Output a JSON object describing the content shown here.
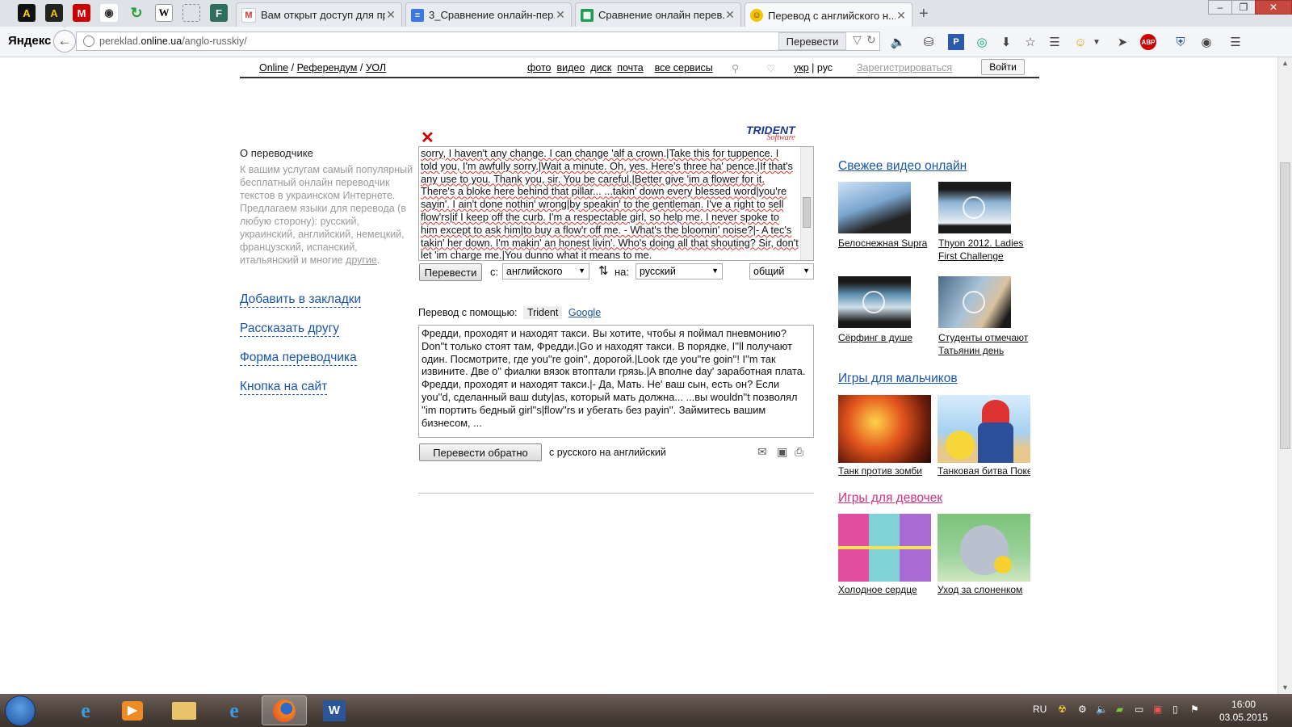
{
  "browser": {
    "tabs": [
      {
        "title": "Вам открыт доступ для пр...",
        "icon": "gmail-icon"
      },
      {
        "title": "3_Сравнение онлайн-пер...",
        "icon": "docs-icon"
      },
      {
        "title": "Сравнение онлайн перев...",
        "icon": "sheets-icon"
      },
      {
        "title": "Перевод с английского н...",
        "icon": "smiley-icon",
        "active": true
      }
    ],
    "logo": "Яндекс",
    "url_prefix": "pereklad.",
    "url_domain": "online.ua",
    "url_path": "/anglo-russkiy/",
    "translate_button": "Перевести",
    "abp_badge": "ABP"
  },
  "topnav": {
    "online": "Online",
    "referendum": "Референдум",
    "uol": "УОЛ",
    "sep": "/",
    "foto": "фото",
    "video": "видео",
    "disk": "диск",
    "pochta": "почта",
    "all_services": "все сервисы",
    "ukr": "укр",
    "lang_sep": "|",
    "rus": "рус",
    "register": "Зарегистрироваться",
    "login": "Войти"
  },
  "sidebar": {
    "title": "О переводчике",
    "description": "К вашим услугам самый популярный бесплатный онлайн переводчик текстов в украинском Интернете. Предлагаем языки для перевода (в любую сторону): русский, украинский, английский, немецкий, французский, испанский, итальянский и многие ",
    "others_link": "другие",
    "period": ".",
    "links": [
      "Добавить в закладки",
      "Рассказать другу",
      "Форма переводчика",
      "Кнопка на сайт"
    ]
  },
  "translator": {
    "logo_main": "TRIDENT",
    "logo_sub": "Software",
    "source_lines": [
      "sorry, I haven't any change. I can change 'alf a crown.|Take this for tuppence. I",
      "told you, I'm awfully sorry.|Wait a minute. Oh, yes. Here's three ha' pence.|If that's",
      "any use to you. Thank you, sir. You be careful.|Better give 'im a flower for it.",
      "There's a bloke here behind that pillar... ...takin' down every blessed word|you're",
      "sayin'. I ain't done nothin' wrong|by speakin' to the gentleman. I've a right to sell",
      "flow'rs|if I keep off the curb. I'm a respectable girl, so help me. I never spoke to",
      "him except to ask him|to buy a flow'r off me. - What's the bloomin' noise?|- A tec's",
      "takin' her down. I'm makin' an honest livin'. Who's doing all that shouting? Sir, don't",
      "let 'im charge me.|You dunno what it means to me."
    ],
    "translate_button": "Перевести",
    "from_label": "с:",
    "from_value": "английского",
    "to_label": "на:",
    "to_value": "русский",
    "topic_value": "общий",
    "via_label": "Перевод с помощью:",
    "via_trident": "Trident",
    "via_google": "Google",
    "output_text": "Фредди, проходят и находят такси. Вы хотите, чтобы я поймал пневмонию? Don''t только стоят там, Фредди.|Go и находят такси. В порядке, I''ll получают один. Посмотрите, где you''re goin'', дорогой.|Look где you''re goin''! I''m так извините. Две о'' фиалки вязок втоптали грязь.|A вполне day' заработная плата.  Фредди, проходят и находят такси.|- Да, Мать. Не' ваш сын, есть он? Если you''d, сделанный ваш duty|as, который мать должна... ...вы wouldn''t позволял ''im портить бедный girl''s|flow''rs и убегать без payin''. Займитесь вашим бизнесом, ...",
    "back_button": "Перевести обратно",
    "back_direction": "с русского на английский"
  },
  "right": {
    "video_heading": "Свежее видео онлайн",
    "videos": [
      {
        "caption": "Белоснежная Supra"
      },
      {
        "caption": "Thyon 2012. Ladies First Challenge"
      },
      {
        "caption": "Сёрфинг в душе"
      },
      {
        "caption": "Студенты отмечают Татьянин день"
      }
    ],
    "boys_heading": "Игры для мальчиков",
    "boys_games": [
      {
        "caption": "Танк против зомби"
      },
      {
        "caption": "Танковая битва Покемон"
      }
    ],
    "girls_heading": "Игры для девочек",
    "girls_games": [
      {
        "caption": "Холодное сердце"
      },
      {
        "caption": "Уход за слоненком"
      }
    ]
  },
  "taskbar": {
    "lang": "RU",
    "time": "16:00",
    "date": "03.05.2015"
  }
}
